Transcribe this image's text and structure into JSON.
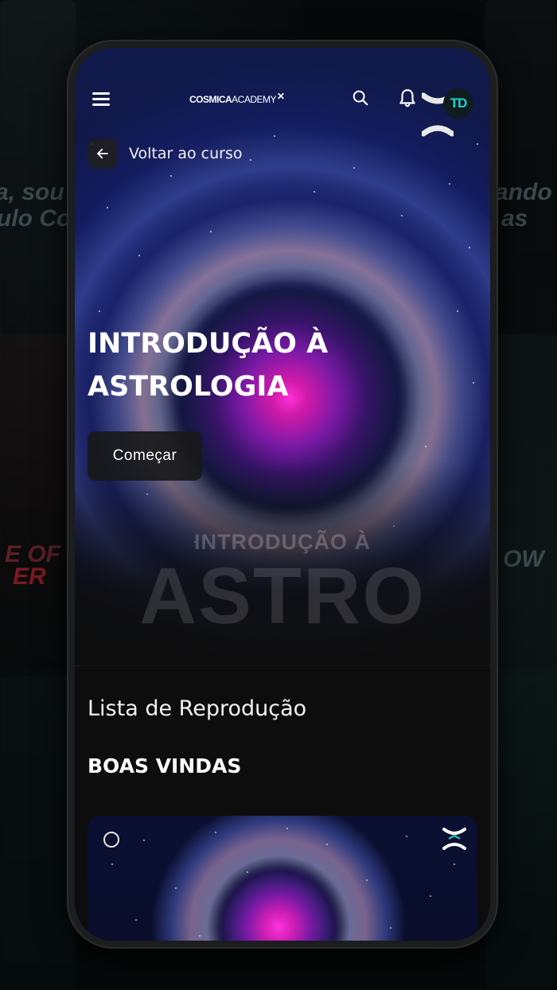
{
  "background": {
    "fragments": [
      "a, sou",
      "ulo Co",
      "ando",
      "as",
      "E OF",
      "ER",
      "OW"
    ]
  },
  "topbar": {
    "menu_icon": "hamburger-menu-icon",
    "brand_bold": "COSMICA",
    "brand_light": "ACADEMY",
    "brand_mark": "✕",
    "search_icon": "search-icon",
    "bell_icon": "bell-icon",
    "avatar_text": "TD"
  },
  "back": {
    "label": "Voltar ao curso",
    "icon": "arrow-left-icon"
  },
  "hero": {
    "title": "INTRODUÇÃO À ASTROLOGIA",
    "start_label": "Começar",
    "watermark_small": "INTRODUÇÃO À",
    "watermark_big": "ASTRO"
  },
  "playlist": {
    "title": "Lista de Reprodução",
    "section": "BOAS VINDAS"
  },
  "colors": {
    "accent": "#19d6c9",
    "nebula_core": "#ff2fd6",
    "screen_bg": "#0d0d0d"
  }
}
